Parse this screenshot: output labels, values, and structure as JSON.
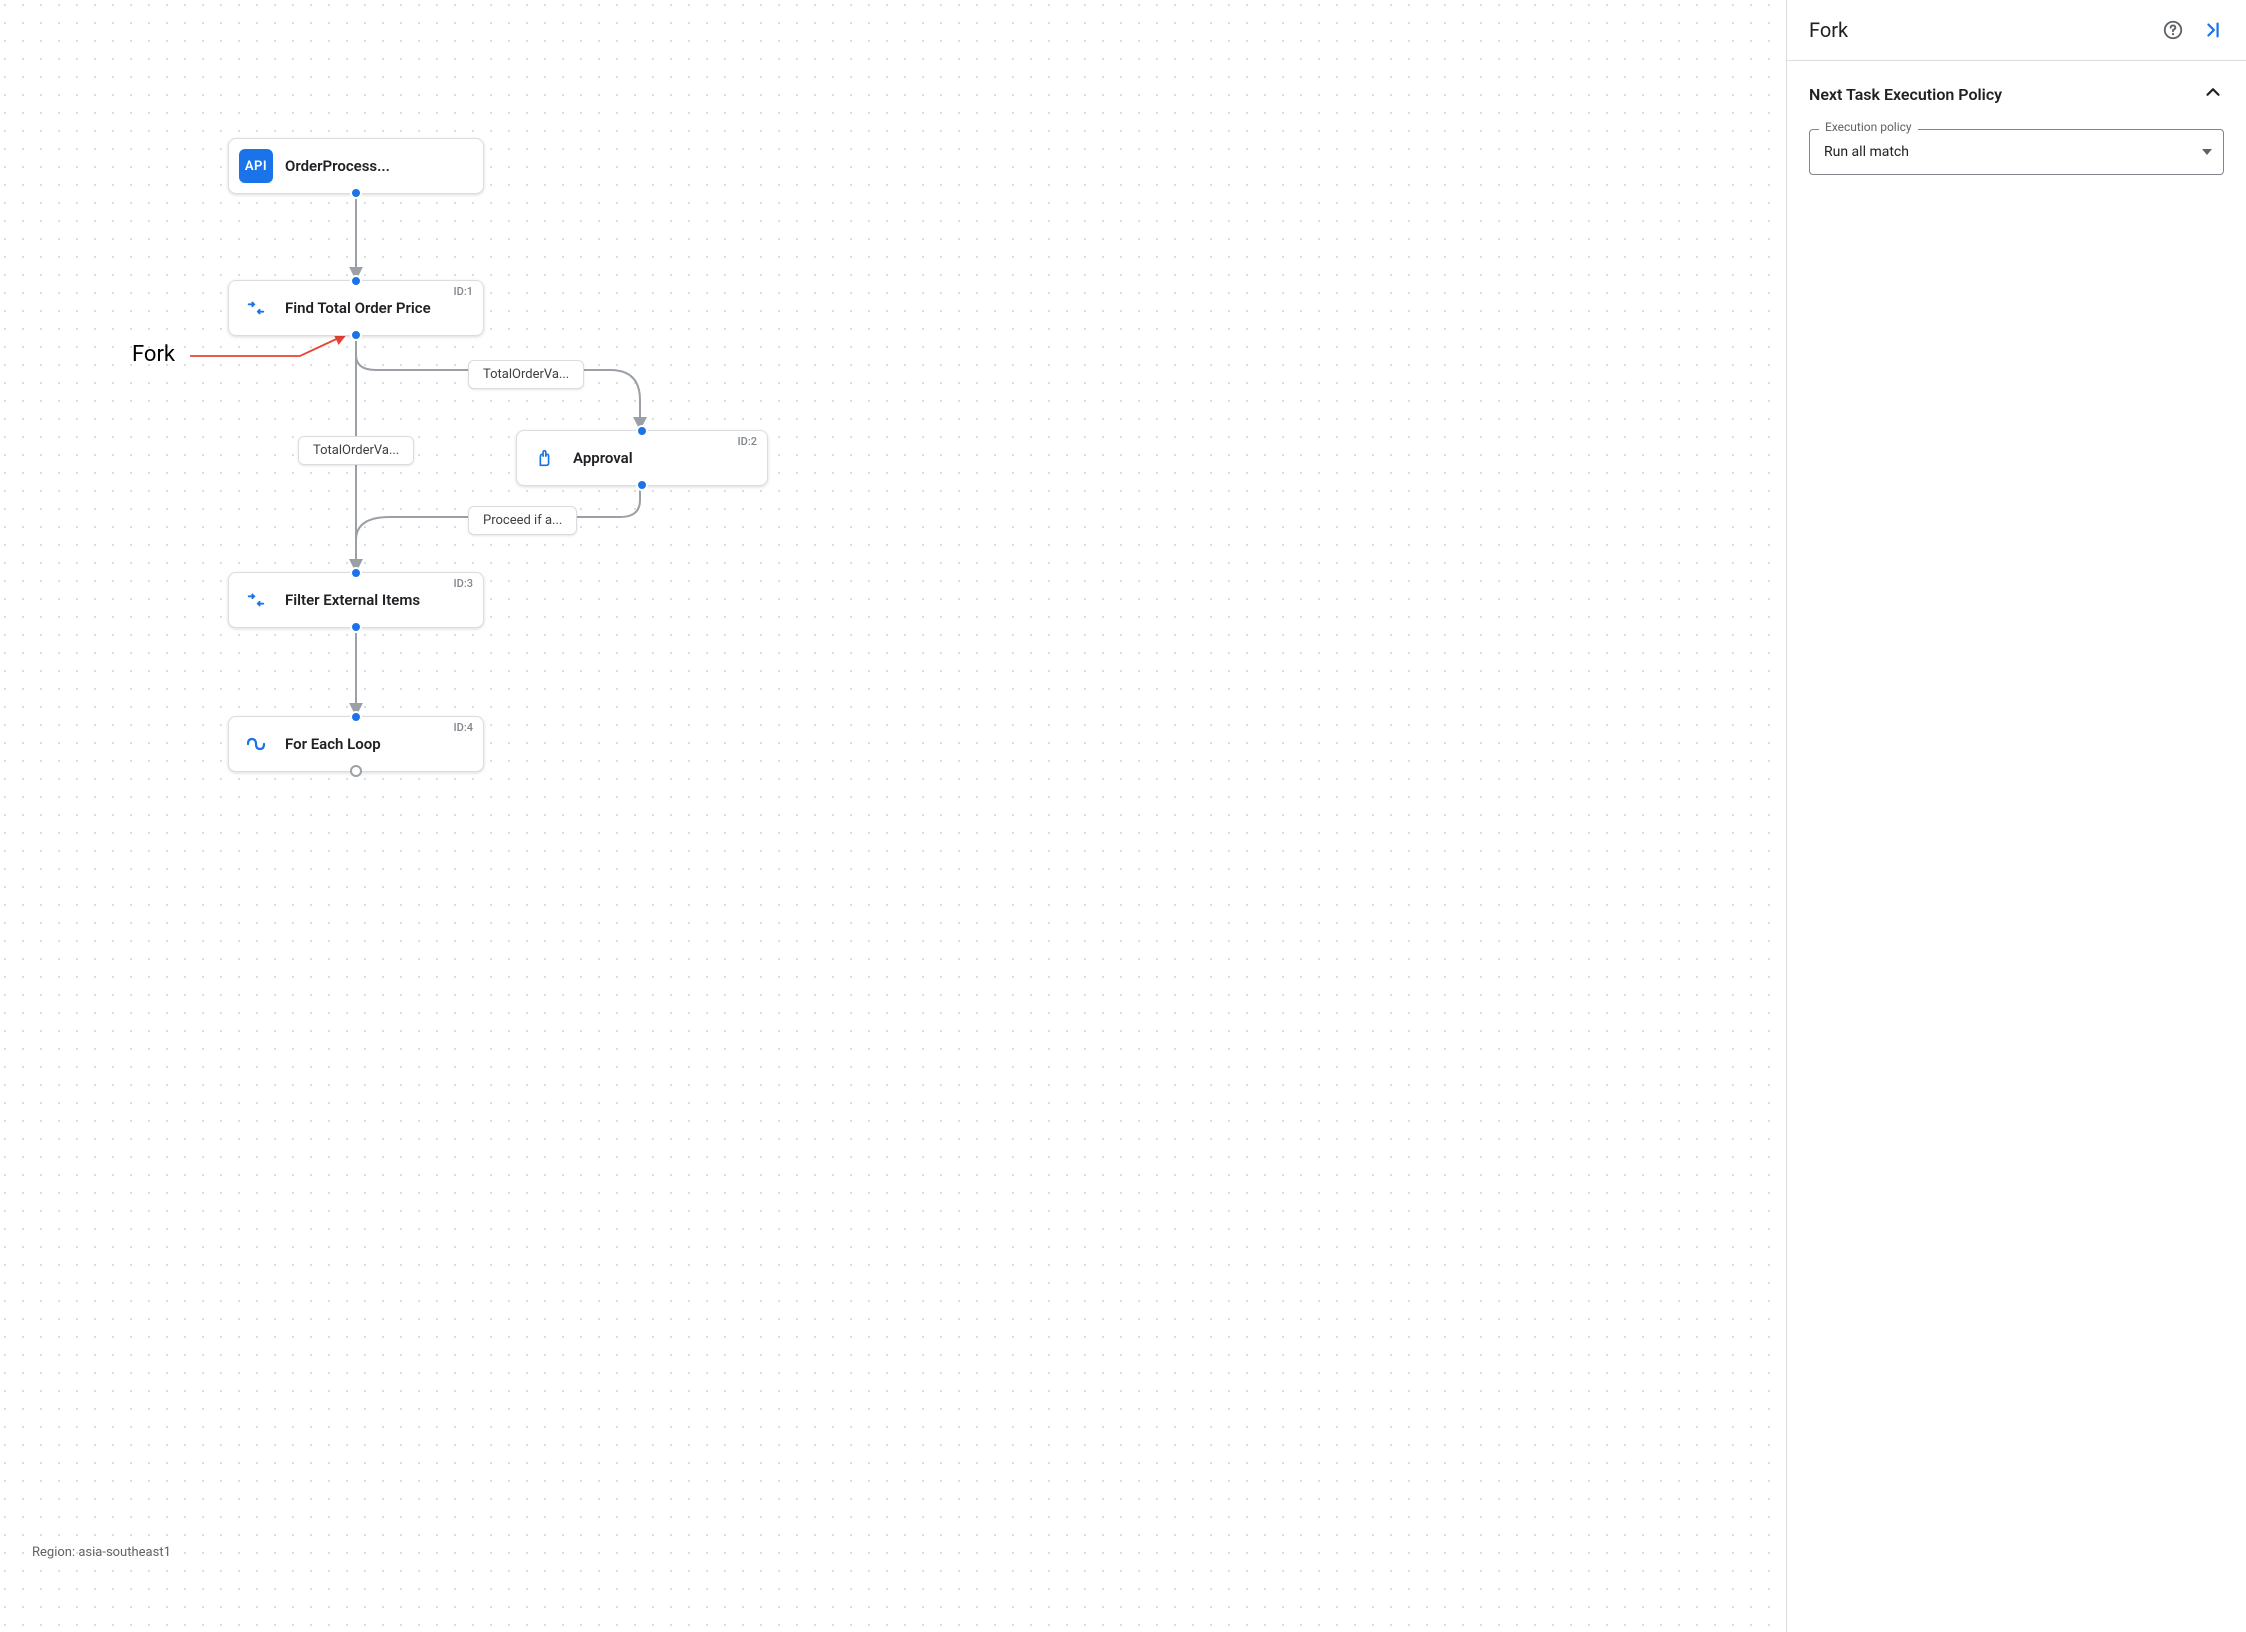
{
  "canvas": {
    "region_label": "Region: asia-southeast1",
    "annotation_text": "Fork",
    "nodes": {
      "trigger": {
        "title": "OrderProcess...",
        "icon_text": "API"
      },
      "task1": {
        "title": "Find Total Order Price",
        "id_label": "ID:1"
      },
      "task2": {
        "title": "Approval",
        "id_label": "ID:2"
      },
      "task3": {
        "title": "Filter External Items",
        "id_label": "ID:3"
      },
      "task4": {
        "title": "For Each Loop",
        "id_label": "ID:4"
      }
    },
    "edge_labels": {
      "t1_to_t2": "TotalOrderVa...",
      "t1_to_t3": "TotalOrderVa...",
      "t2_to_t3": "Proceed if a..."
    }
  },
  "panel": {
    "title": "Fork",
    "section_title": "Next Task Execution Policy",
    "field_label": "Execution policy",
    "field_value": "Run all match"
  }
}
